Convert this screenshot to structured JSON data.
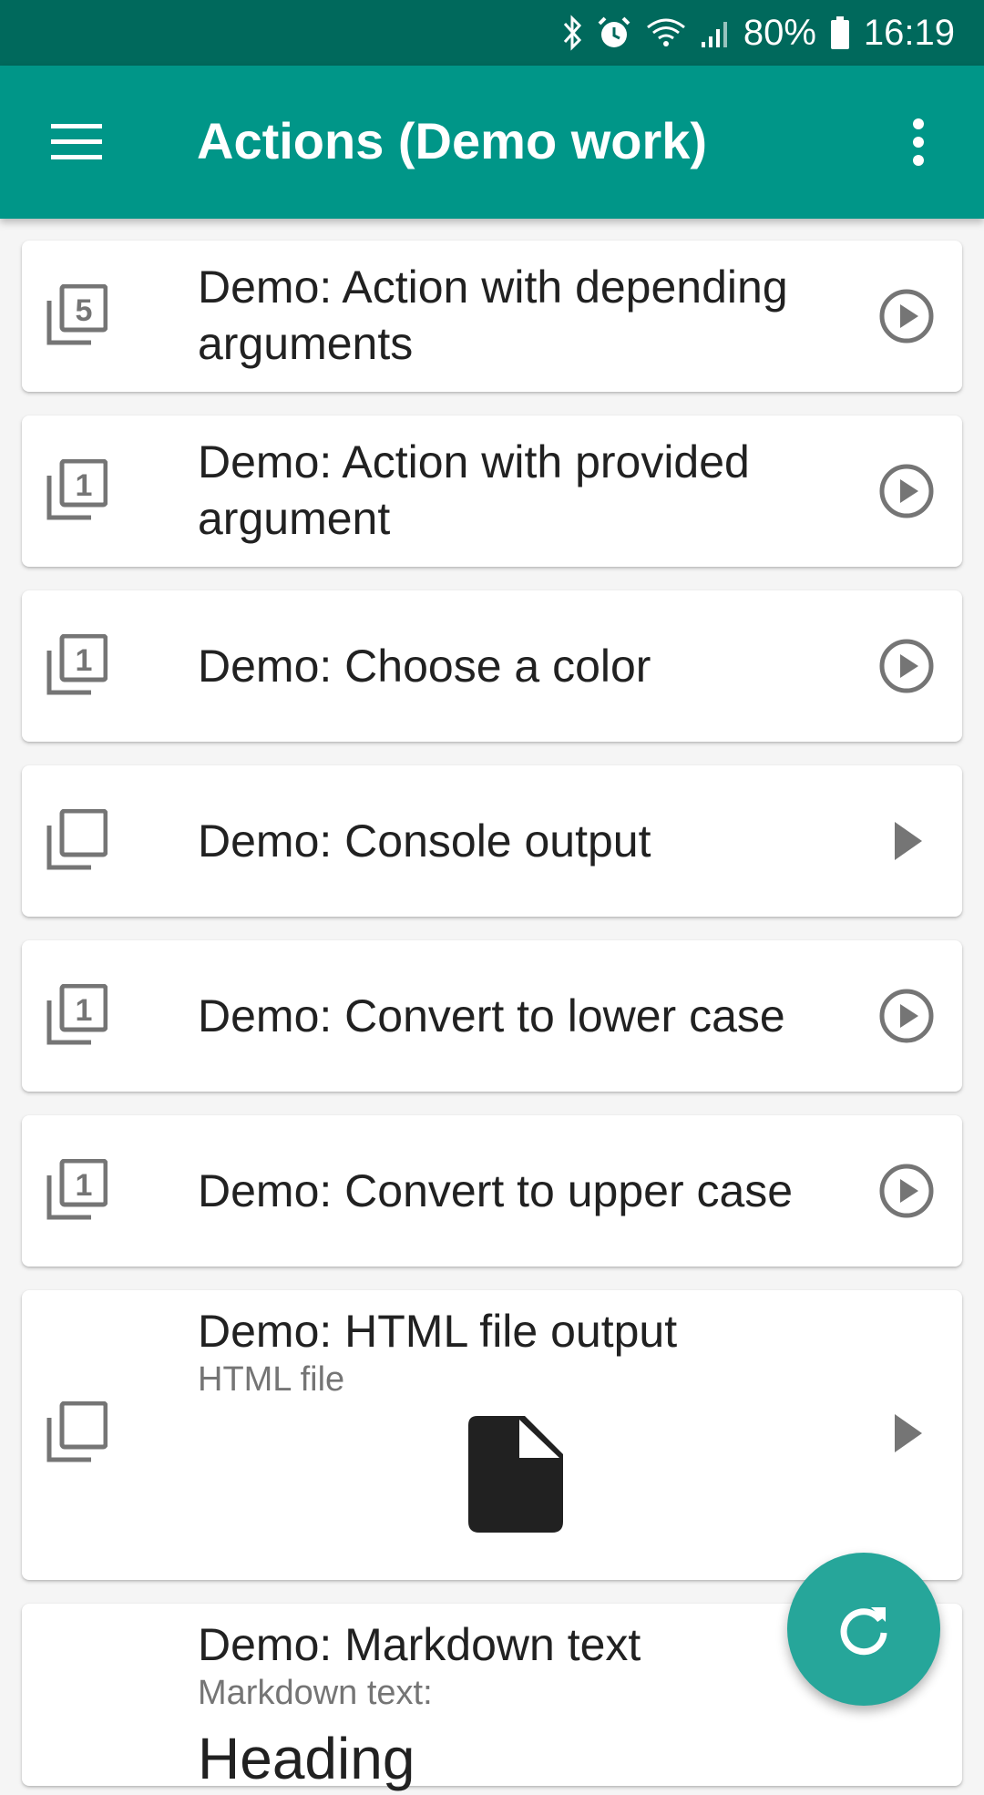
{
  "status_bar": {
    "battery": "80%",
    "time": "16:19",
    "icons": [
      "bluetooth-icon",
      "alarm-icon",
      "wifi-icon",
      "signal-icon",
      "battery-icon"
    ]
  },
  "app_bar": {
    "title": "Actions (Demo work)",
    "color": "#009688",
    "status_color": "#00695c"
  },
  "actions": [
    {
      "title": "Demo: Action with depending arguments",
      "badge": "5",
      "leading_icon": "library-5-icon",
      "trailing_icon": "play-circle-icon"
    },
    {
      "title": "Demo: Action with provided argument",
      "badge": "1",
      "leading_icon": "library-1-icon",
      "trailing_icon": "play-circle-icon"
    },
    {
      "title": "Demo: Choose a color",
      "badge": "1",
      "leading_icon": "library-1-icon",
      "trailing_icon": "play-circle-icon"
    },
    {
      "title": "Demo: Console output",
      "badge": "",
      "leading_icon": "library-icon",
      "trailing_icon": "play-arrow-icon"
    },
    {
      "title": "Demo: Convert to lower case",
      "badge": "1",
      "leading_icon": "library-1-icon",
      "trailing_icon": "play-circle-icon"
    },
    {
      "title": "Demo: Convert to upper case",
      "badge": "1",
      "leading_icon": "library-1-icon",
      "trailing_icon": "play-circle-icon"
    },
    {
      "title": "Demo: HTML file output",
      "subtitle": "HTML file",
      "badge": "",
      "leading_icon": "library-icon",
      "trailing_icon": "play-arrow-icon",
      "content_icon": "file-icon"
    },
    {
      "title": "Demo: Markdown text",
      "subtitle": "Markdown text:",
      "preview": "Heading"
    }
  ],
  "fab": {
    "icon": "refresh-icon",
    "color": "#26a69a"
  }
}
